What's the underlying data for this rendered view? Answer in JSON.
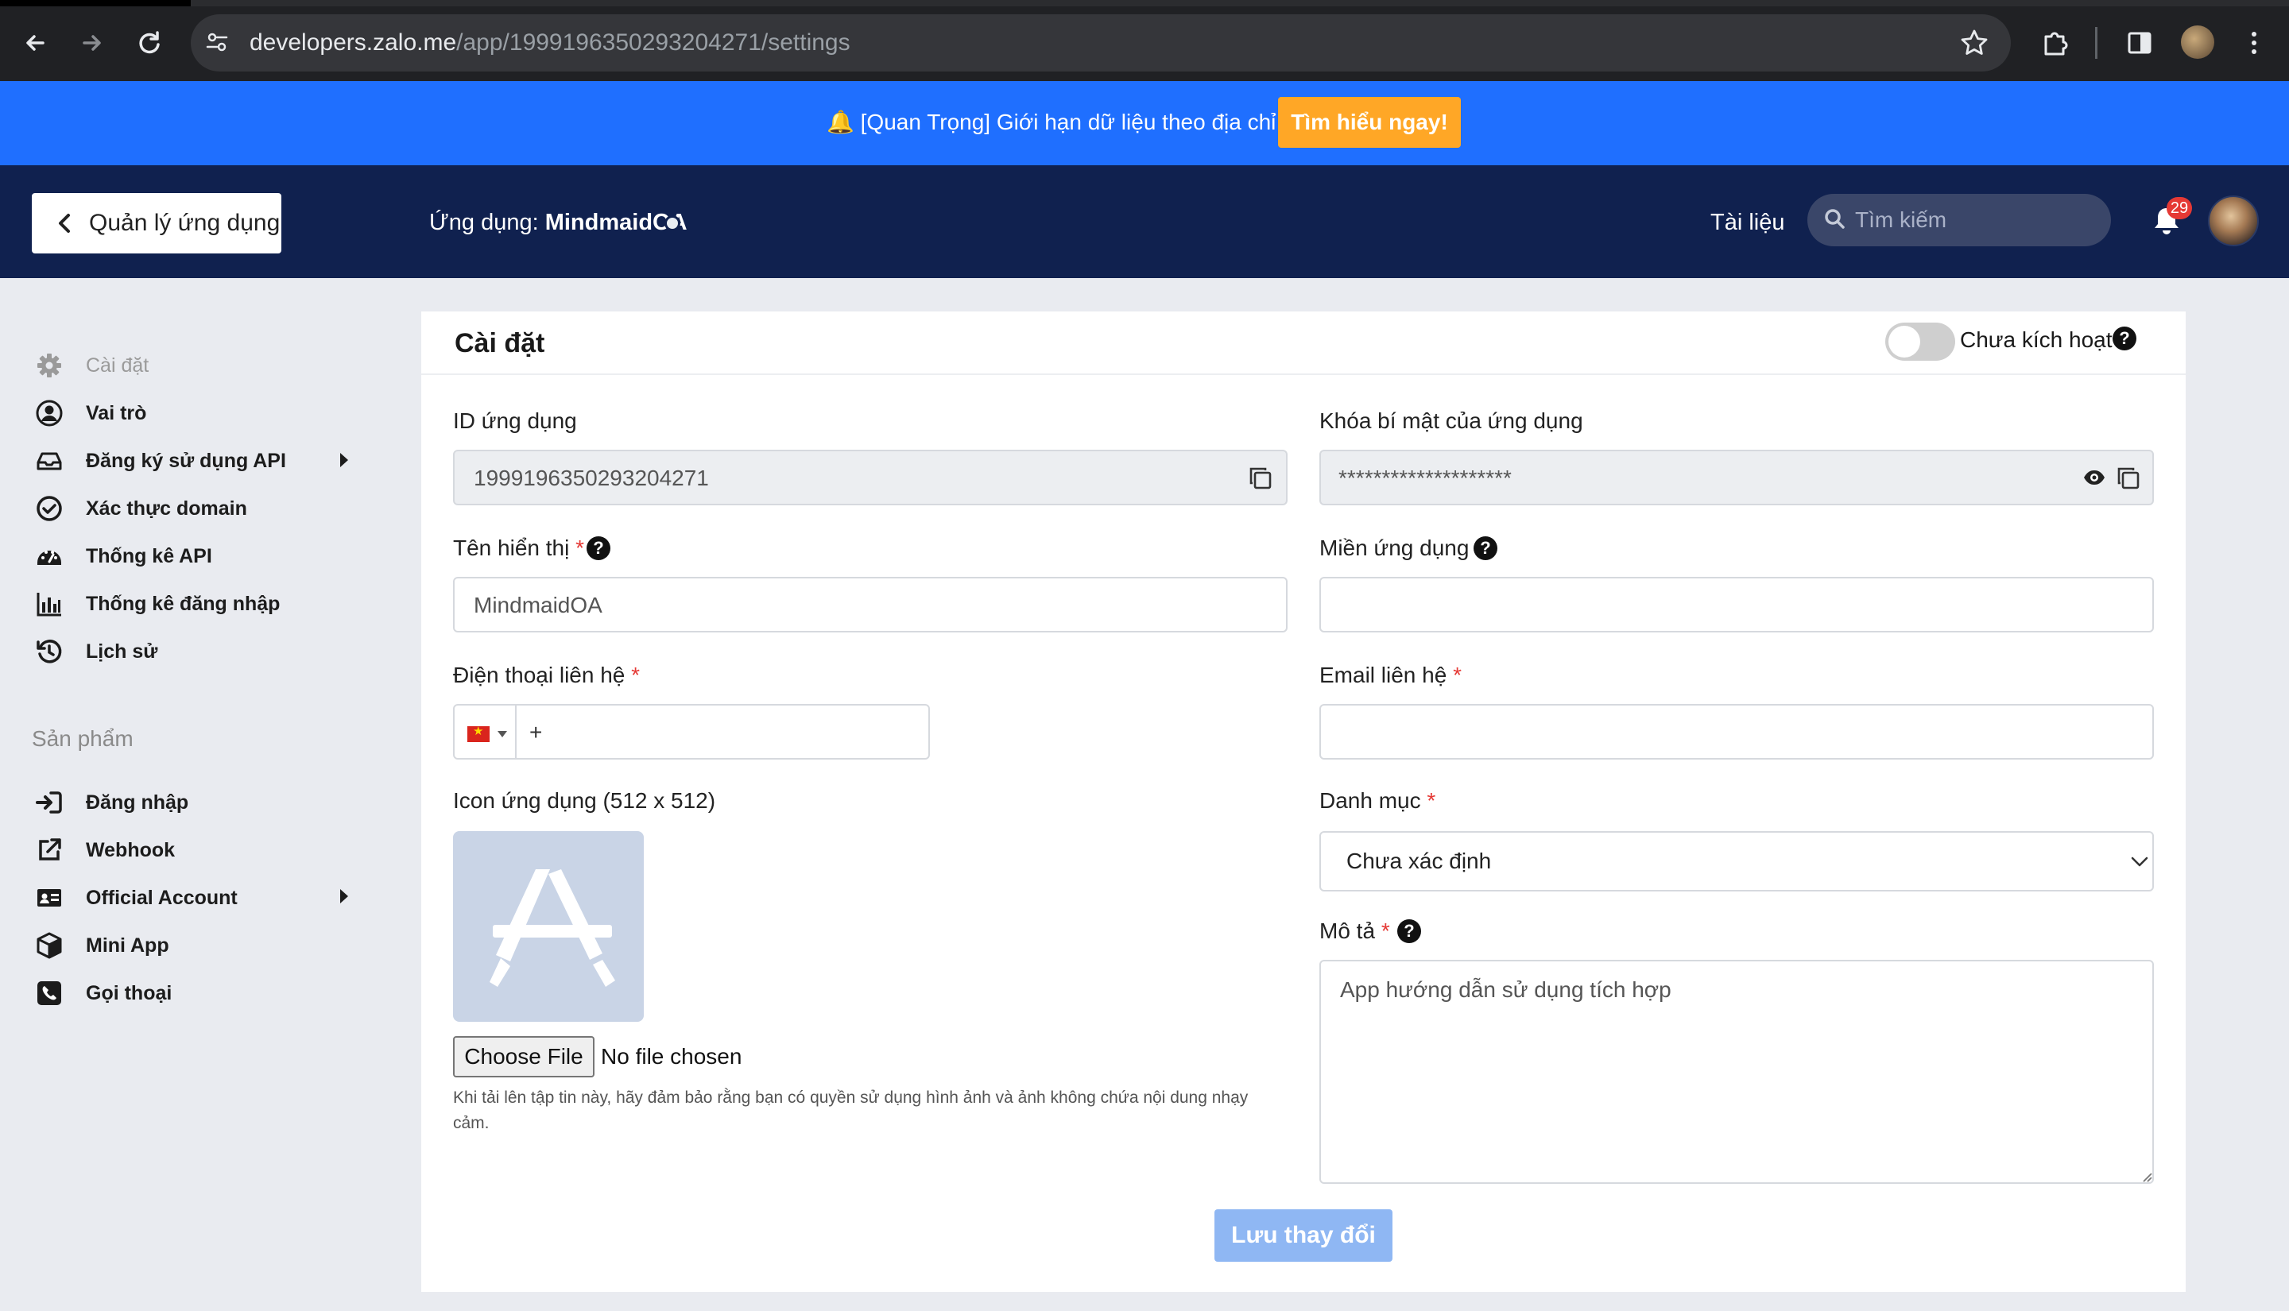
{
  "browser": {
    "url_host": "developers.zalo.me",
    "url_path": "/app/1999196350293204271/settings"
  },
  "notice": {
    "text": "🔔 [Quan Trọng] Giới hạn dữ liệu theo địa chỉ IP",
    "button": "Tìm hiểu ngay!"
  },
  "header": {
    "back_label": "Quản lý ứng dụng",
    "app_prefix": "Ứng dụng: ",
    "app_name": "MindmaidOA",
    "docs_link": "Tài liệu",
    "search_placeholder": "Tìm kiếm",
    "notification_count": "29"
  },
  "sidebar": {
    "items": [
      {
        "label": "Cài đặt",
        "icon": "gear-icon",
        "active": true
      },
      {
        "label": "Vai trò",
        "icon": "user-circle-icon"
      },
      {
        "label": "Đăng ký sử dụng API",
        "icon": "inbox-icon",
        "has_submenu": true
      },
      {
        "label": "Xác thực domain",
        "icon": "check-circle-icon"
      },
      {
        "label": "Thống kê API",
        "icon": "dashboard-icon"
      },
      {
        "label": "Thống kê đăng nhập",
        "icon": "bar-chart-icon"
      },
      {
        "label": "Lịch sử",
        "icon": "history-icon"
      }
    ],
    "section_title": "Sản phẩm",
    "products": [
      {
        "label": "Đăng nhập",
        "icon": "sign-in-icon"
      },
      {
        "label": "Webhook",
        "icon": "external-link-icon"
      },
      {
        "label": "Official Account",
        "icon": "id-card-icon",
        "has_submenu": true
      },
      {
        "label": "Mini App",
        "icon": "cube-icon"
      },
      {
        "label": "Gọi thoại",
        "icon": "phone-icon"
      }
    ]
  },
  "settings": {
    "title": "Cài đặt",
    "activation_label": "Chưa kích hoạt",
    "app_id_label": "ID ứng dụng",
    "app_id_value": "1999196350293204271",
    "secret_label": "Khóa bí mật của ứng dụng",
    "secret_value": "********************",
    "display_name_label": "Tên hiển thị",
    "display_name_value": "MindmaidOA",
    "domain_label": "Miền ứng dụng",
    "domain_value": "",
    "phone_label": "Điện thoại liên hệ",
    "phone_prefix": "+",
    "phone_value": "",
    "email_label": "Email liên hệ",
    "email_value": "",
    "icon_label": "Icon ứng dụng (512 x 512)",
    "file_button": "Choose File",
    "file_status": "No file chosen",
    "file_hint": "Khi tải lên tập tin này, hãy đảm bảo rằng bạn có quyền sử dụng hình ảnh và ảnh không chứa nội dung nhạy cảm.",
    "category_label": "Danh mục",
    "category_value": "Chưa xác định",
    "description_label": "Mô tả",
    "description_value": "App hướng dẫn sử dụng tích hợp",
    "save_button": "Lưu thay đổi",
    "required_mark": "*"
  },
  "colors": {
    "browser_bg": "#202124",
    "notice_bg": "#1f6fff",
    "notice_button": "#ffa726",
    "header_bg": "#10214f",
    "page_bg": "#e9ebf0",
    "save_button": "#8fb7f3",
    "required": "#e53935"
  }
}
